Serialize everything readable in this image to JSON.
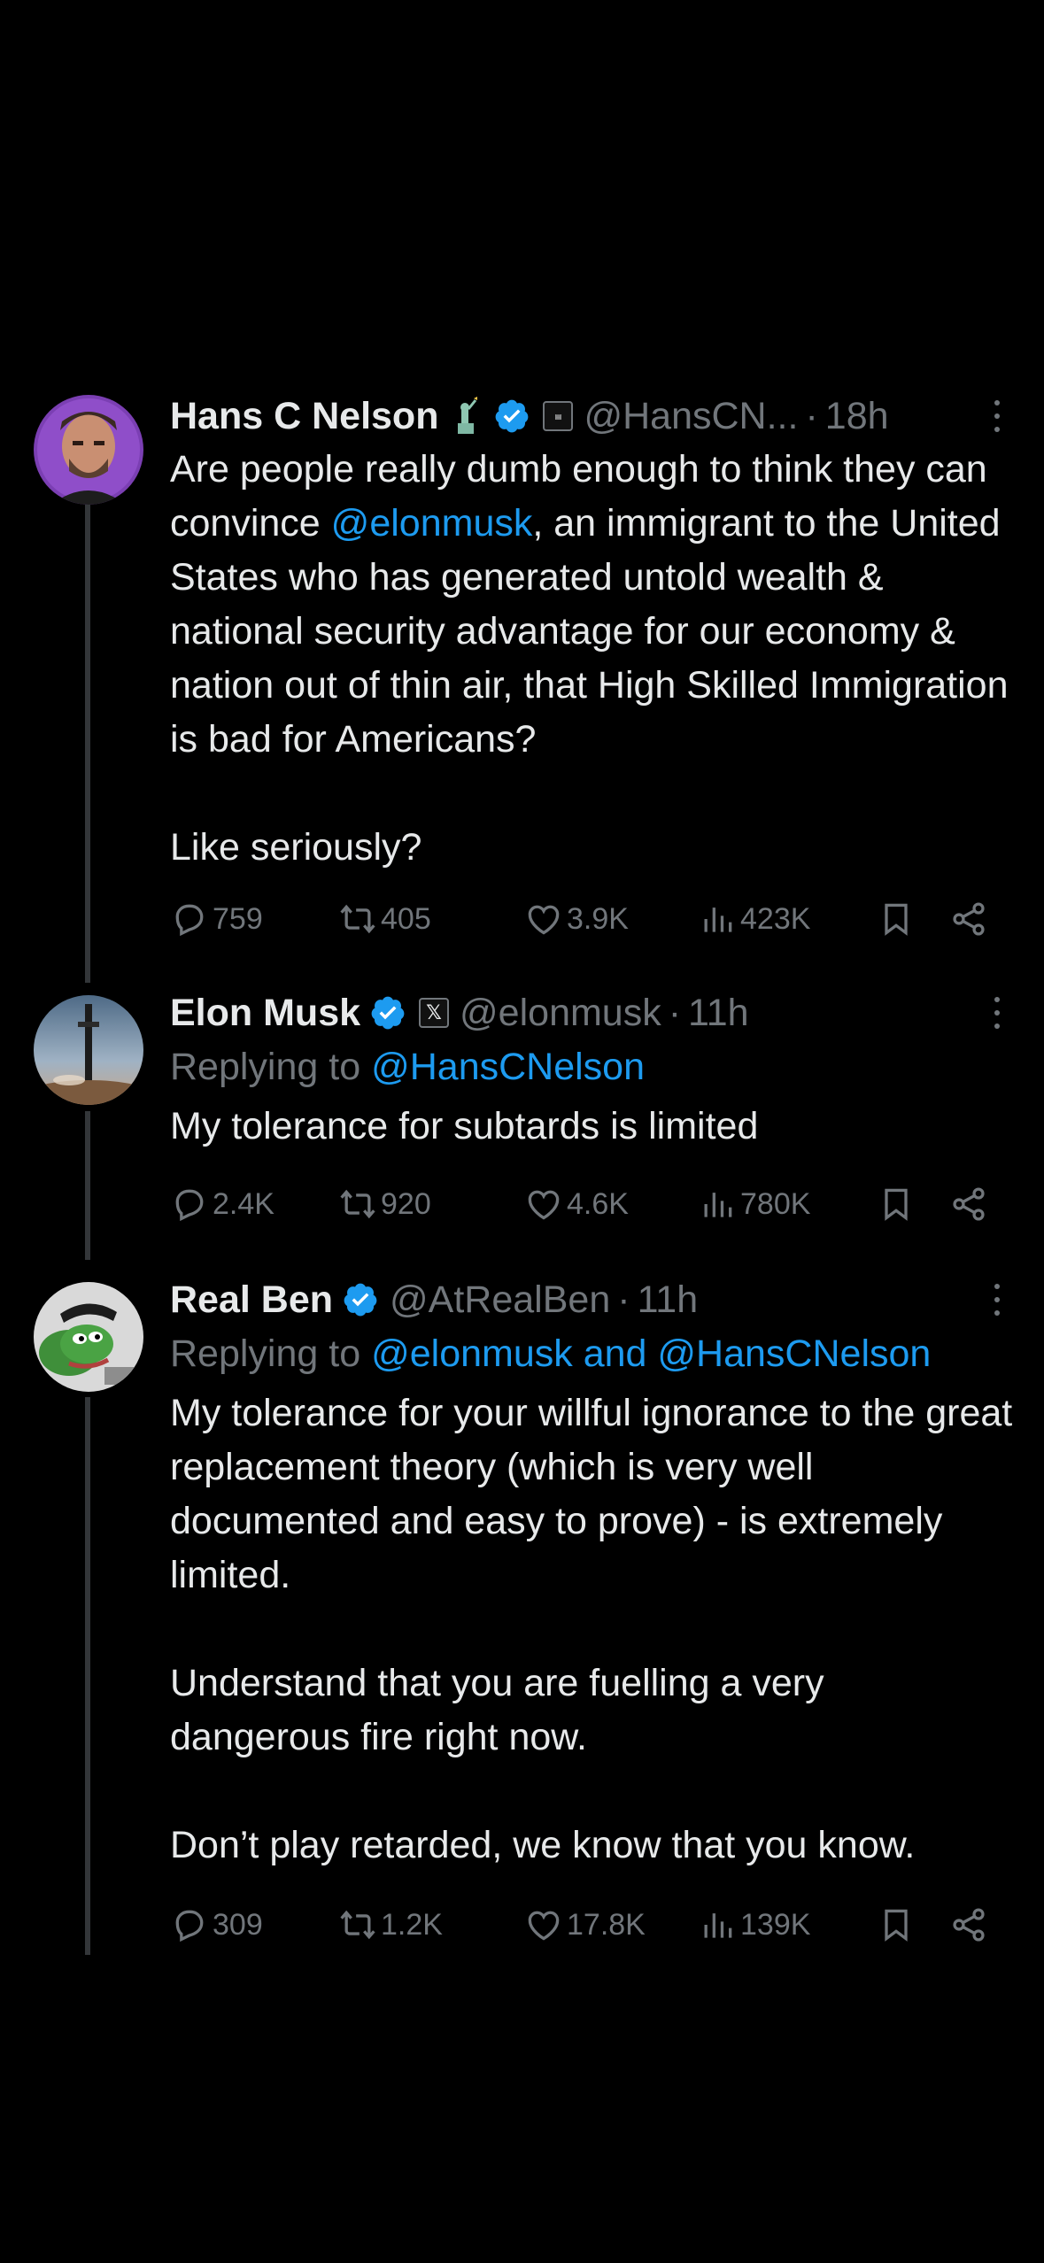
{
  "tweets": [
    {
      "name": "Hans C Nelson",
      "handle": "@HansCN...",
      "time": "18h",
      "replying": null,
      "body_parts": [
        {
          "text": "Are people really dumb enough to think they can convince ",
          "mention": false
        },
        {
          "text": "@elonmusk",
          "mention": true
        },
        {
          "text": ", an immigrant to the United States who has generated untold wealth & national security advantage for our economy & nation out of thin air, that High Skilled Immigration is bad for Americans?",
          "mention": false
        }
      ],
      "body_extra": [
        "Like seriously?"
      ],
      "replies": "759",
      "retweets": "405",
      "likes": "3.9K",
      "views": "423K"
    },
    {
      "name": "Elon Musk",
      "handle": "@elonmusk",
      "time": "11h",
      "replying_prefix": "Replying to ",
      "replying_mentions": "@HansCNelson",
      "body": "My tolerance for subtards is limited",
      "replies": "2.4K",
      "retweets": "920",
      "likes": "4.6K",
      "views": "780K"
    },
    {
      "name": "Real Ben",
      "handle": "@AtRealBen",
      "time": "11h",
      "replying_prefix": "Replying to ",
      "replying_mentions": "@elonmusk and @HansCNelson",
      "body_paragraphs": [
        "My tolerance for your willful ignorance to the great replacement theory (which is very well documented and easy to prove) - is extremely limited.",
        "Understand that you are fuelling a very dangerous fire right now.",
        "Don’t play retarded, we know that you know."
      ],
      "replies": "309",
      "retweets": "1.2K",
      "likes": "17.8K",
      "views": "139K"
    }
  ],
  "separator": "·",
  "colors": {
    "background": "#000000",
    "text": "#e7e9ea",
    "muted": "#71767b",
    "accent": "#1d9bf0",
    "thread_line": "#333639"
  },
  "icons": [
    "more-icon",
    "verified-badge-icon",
    "reply-icon",
    "retweet-icon",
    "like-icon",
    "views-icon",
    "bookmark-icon",
    "share-icon"
  ]
}
